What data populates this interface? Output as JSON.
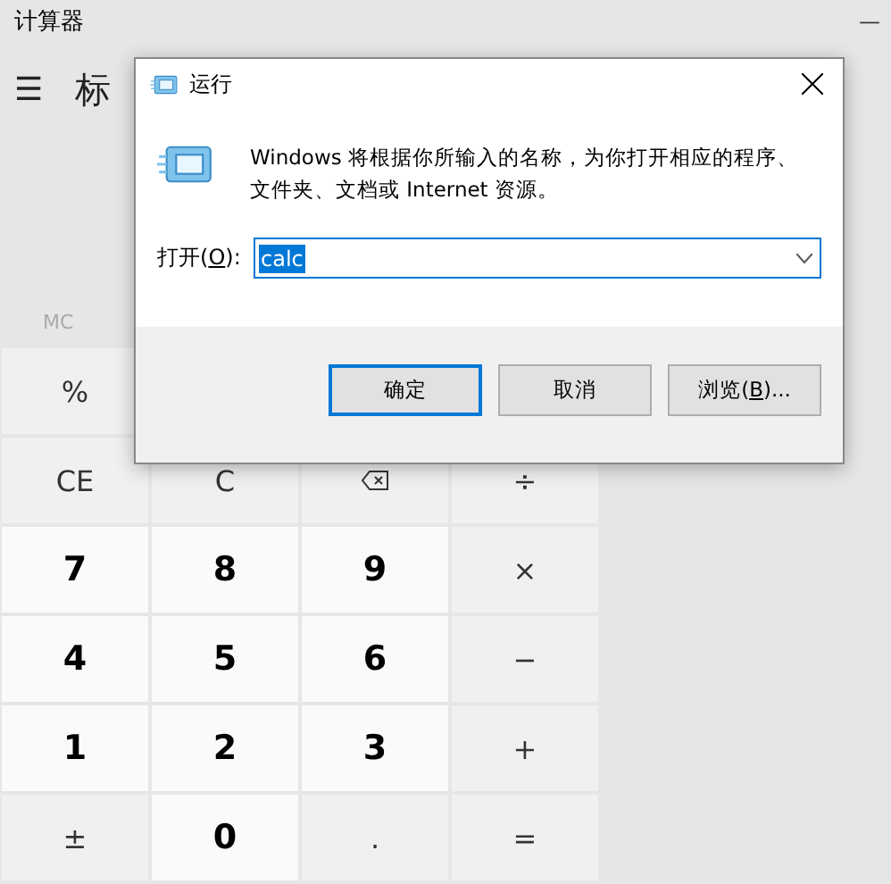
{
  "calculator": {
    "title": "计算器",
    "minimize": "—",
    "menu": "☰",
    "mode_title": "标",
    "memory": "MC",
    "keys": [
      {
        "label": "%",
        "kind": "op"
      },
      {
        "label": "CE",
        "kind": "op"
      },
      {
        "label": "C",
        "kind": "op"
      },
      {
        "kind": "backspace"
      },
      {
        "label": "÷",
        "kind": "op"
      },
      {
        "label": "7",
        "kind": "digit"
      },
      {
        "label": "8",
        "kind": "digit"
      },
      {
        "label": "9",
        "kind": "digit"
      },
      {
        "label": "×",
        "kind": "op"
      },
      {
        "label": "4",
        "kind": "digit"
      },
      {
        "label": "5",
        "kind": "digit"
      },
      {
        "label": "6",
        "kind": "digit"
      },
      {
        "label": "−",
        "kind": "op"
      },
      {
        "label": "1",
        "kind": "digit"
      },
      {
        "label": "2",
        "kind": "digit"
      },
      {
        "label": "3",
        "kind": "digit"
      },
      {
        "label": "+",
        "kind": "op"
      },
      {
        "label": "±",
        "kind": "op"
      },
      {
        "label": "0",
        "kind": "digit"
      },
      {
        "label": ".",
        "kind": "op"
      },
      {
        "label": "=",
        "kind": "op"
      }
    ]
  },
  "run_dialog": {
    "title": "运行",
    "description": "Windows 将根据你所输入的名称，为你打开相应的程序、文件夹、文档或 Internet 资源。",
    "open_label": {
      "before": "打开(",
      "key": "O",
      "after": "):"
    },
    "value": "calc",
    "value_selected": true,
    "buttons": [
      {
        "before": "确定",
        "default": true
      },
      {
        "before": "取消",
        "default": false
      },
      {
        "before": "浏览(",
        "key": "B",
        "after": ")...",
        "default": false
      }
    ]
  }
}
